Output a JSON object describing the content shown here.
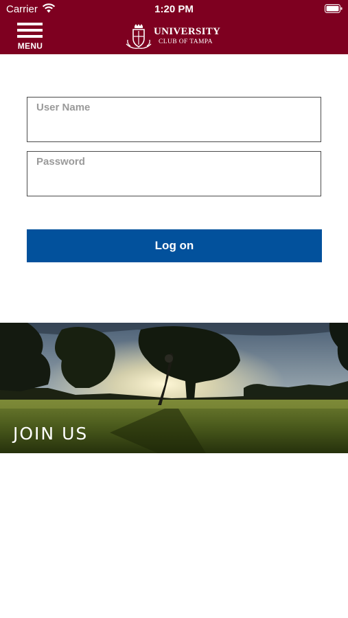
{
  "status_bar": {
    "carrier": "Carrier",
    "time": "1:20 PM"
  },
  "header": {
    "menu_label": "MENU",
    "logo": {
      "name": "UNIVERSITY",
      "subtitle": "CLUB OF TAMPA"
    },
    "brand_color": "#7e0020"
  },
  "login_form": {
    "username_label": "User Name",
    "username_value": "",
    "password_label": "Password",
    "password_value": "",
    "logon_label": "Log on",
    "button_color": "#02519c"
  },
  "banner": {
    "label": "JOIN US"
  }
}
